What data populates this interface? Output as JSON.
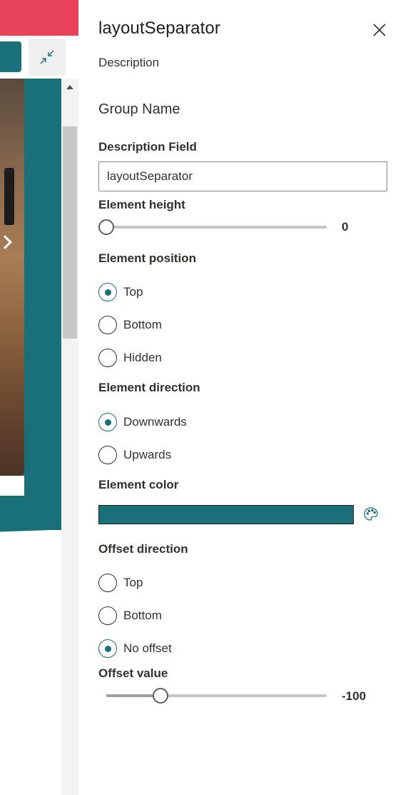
{
  "pane": {
    "title": "layoutSeparator",
    "description": "Description",
    "group_name": "Group Name"
  },
  "description_field": {
    "label": "Description Field",
    "value": "layoutSeparator"
  },
  "element_height": {
    "label": "Element height",
    "value": "0"
  },
  "element_position": {
    "label": "Element position",
    "options": [
      "Top",
      "Bottom",
      "Hidden"
    ],
    "selected": "Top"
  },
  "element_direction": {
    "label": "Element direction",
    "options": [
      "Downwards",
      "Upwards"
    ],
    "selected": "Downwards"
  },
  "element_color": {
    "label": "Element color",
    "value": "#1a7078"
  },
  "offset_direction": {
    "label": "Offset direction",
    "options": [
      "Top",
      "Bottom",
      "No offset"
    ],
    "selected": "No offset"
  },
  "offset_value": {
    "label": "Offset value",
    "value": "-100"
  },
  "colors": {
    "accent": "#1a7078",
    "brand_bar": "#e8435a"
  }
}
